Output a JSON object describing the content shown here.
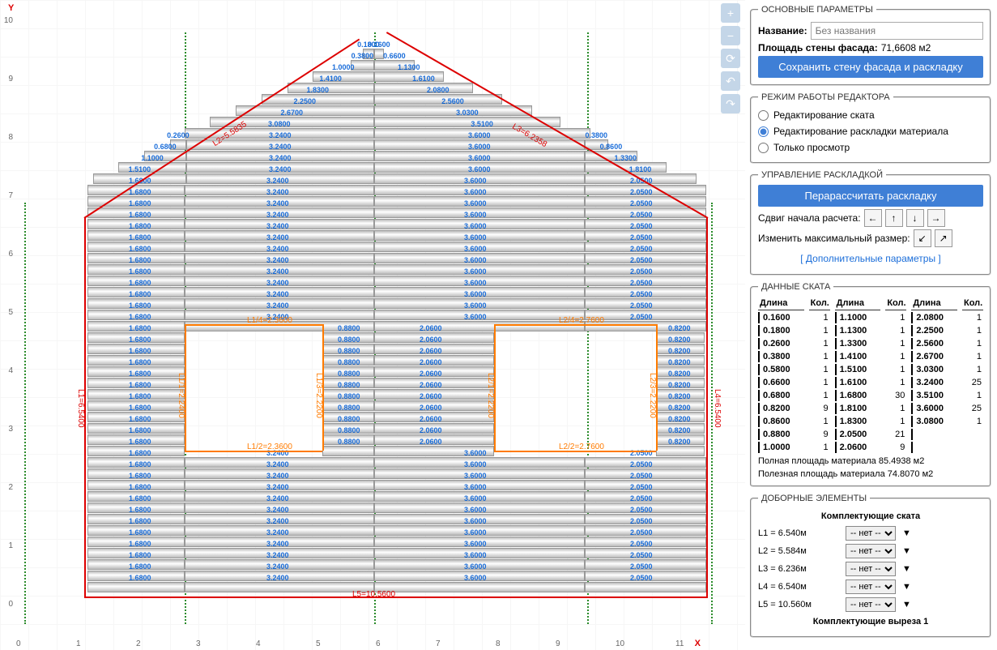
{
  "axes": {
    "yLabel": "Y",
    "xLabel": "X",
    "yTicks": [
      "10",
      "9",
      "8",
      "7",
      "6",
      "5",
      "4",
      "3",
      "2",
      "1",
      "0"
    ],
    "xTicks": [
      "0",
      "1",
      "2",
      "3",
      "4",
      "5",
      "6",
      "7",
      "8",
      "9",
      "10",
      "11"
    ]
  },
  "tools": [
    "plus",
    "minus",
    "refresh",
    "undo",
    "redo"
  ],
  "basic": {
    "title": "ОСНОВНЫЕ ПАРАМЕТРЫ",
    "nameLabel": "Название:",
    "namePlaceholder": "Без названия",
    "areaLabel": "Площадь стены фасада:",
    "areaValue": "71,6608 м2",
    "saveBtn": "Сохранить стену фасада и раскладку"
  },
  "mode": {
    "title": "РЕЖИМ РАБОТЫ РЕДАКТОРА",
    "opts": [
      "Редактирование ската",
      "Редактирование раскладки материала",
      "Только просмотр"
    ],
    "selected": 1
  },
  "layout": {
    "title": "УПРАВЛЕНИЕ РАСКЛАДКОЙ",
    "recalcBtn": "Перарассчитать раскладку",
    "shiftLabel": "Сдвиг начала расчета:",
    "maxSizeLabel": "Изменить максимальный размер:",
    "extra": "[ Дополнительные параметры ]"
  },
  "skatData": {
    "title": "ДАННЫЕ СКАТА",
    "headers": [
      "Длина",
      "Кол.",
      "Длина",
      "Кол.",
      "Длина",
      "Кол."
    ],
    "rows": [
      [
        "0.1600",
        "1",
        "1.1000",
        "1",
        "2.0800",
        "1"
      ],
      [
        "0.1800",
        "1",
        "1.1300",
        "1",
        "2.2500",
        "1"
      ],
      [
        "0.2600",
        "1",
        "1.3300",
        "1",
        "2.5600",
        "1"
      ],
      [
        "0.3800",
        "1",
        "1.4100",
        "1",
        "2.6700",
        "1"
      ],
      [
        "0.5800",
        "1",
        "1.5100",
        "1",
        "3.0300",
        "1"
      ],
      [
        "0.6600",
        "1",
        "1.6100",
        "1",
        "3.2400",
        "25"
      ],
      [
        "0.6800",
        "1",
        "1.6800",
        "30",
        "3.5100",
        "1"
      ],
      [
        "0.8200",
        "9",
        "1.8100",
        "1",
        "3.6000",
        "25"
      ],
      [
        "0.8600",
        "1",
        "1.8300",
        "1",
        "3.0800",
        "1"
      ],
      [
        "0.8800",
        "9",
        "2.0500",
        "21",
        "",
        ""
      ],
      [
        "1.0000",
        "1",
        "2.0600",
        "9",
        "",
        ""
      ]
    ],
    "fullArea": "Полная площадь материала 85.4938 м2",
    "usefulArea": "Полезная площадь материала 74.8070 м2"
  },
  "accessories": {
    "title": "ДОБОРНЫЕ ЭЛЕМЕНТЫ",
    "sub1": "Комплектующие ската",
    "items": [
      {
        "l": "L1 = 6.540м"
      },
      {
        "l": "L2 = 5.584м"
      },
      {
        "l": "L3 = 6.236м"
      },
      {
        "l": "L4 = 6.540м"
      },
      {
        "l": "L5 = 10.560м"
      }
    ],
    "selNone": "-- нет --",
    "sub2": "Комплектующие выреза 1"
  },
  "diagram": {
    "edgeLabels": {
      "L1": "L1=6.5400",
      "L2": "L2=5.5835",
      "L3": "L3=6.2358",
      "L4": "L4=6.5400",
      "L5": "L5=10.5600"
    },
    "cutLabels": {
      "L1_4": "L1/4=2.3600",
      "L2_4": "L2/4=2.7600",
      "L1_2": "L1/2=2.3600",
      "L2_2": "L2/2=2.7600",
      "L1_1": "L1/1=2.2400",
      "L2_1": "L2/1=2.2200",
      "L1_3": "L1/3=2.2200",
      "L2_3": "L2/3=2.2200"
    },
    "stripValues": {
      "peak": [
        "0.1600",
        "0.1800",
        "0.3800",
        "0.6600",
        "1.0000",
        "1.1300",
        "1.4100",
        "1.6100",
        "1.8300",
        "2.0800",
        "2.2500",
        "2.5600",
        "2.6700",
        "3.0300",
        "3.0800",
        "3.5100"
      ],
      "leftSlope": [
        "0.2600",
        "0.6800",
        "1.1000",
        "1.5100"
      ],
      "rightSlope": [
        "0.3800",
        "0.8600",
        "1.3300",
        "1.8100"
      ],
      "leftCol": "1.6800",
      "midLeft": "3.2400",
      "midRight": "3.6000",
      "rightCol": "2.0500",
      "winMidL": "0.8800",
      "winMidR": "2.0600",
      "winRight": "0.8200"
    }
  }
}
